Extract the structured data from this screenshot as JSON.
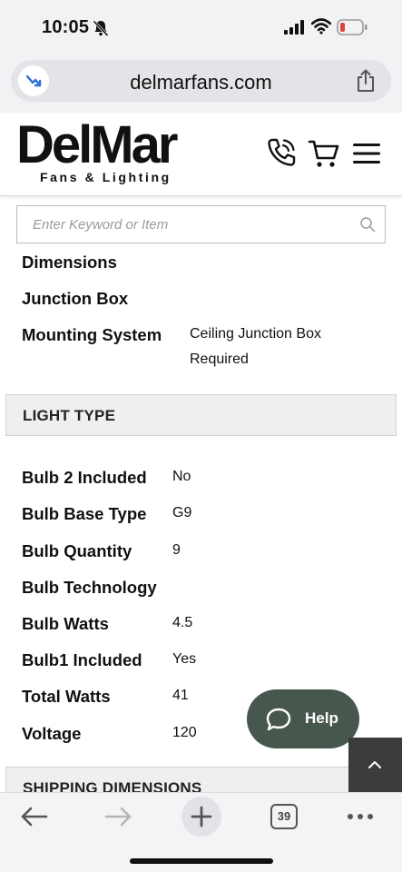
{
  "status_bar": {
    "time": "10:05",
    "icons": [
      "bell-muted-icon",
      "signal-icon",
      "wifi-icon",
      "battery-low-icon"
    ],
    "battery_color": "#e0443e"
  },
  "browser": {
    "url": "delmarfans.com",
    "tab_count": "39",
    "icons": [
      "back-icon",
      "forward-icon",
      "new-tab-icon",
      "tabs-icon",
      "more-icon",
      "share-icon"
    ]
  },
  "site": {
    "logo": "DelMar",
    "tagline": "Fans & Lighting",
    "header_icons": [
      "phone-icon",
      "cart-icon",
      "menu-icon"
    ]
  },
  "search": {
    "placeholder": "Enter Keyword or Item",
    "value": ""
  },
  "specs_top": [
    {
      "label": "Dimensions",
      "value": ""
    },
    {
      "label": "Junction Box",
      "value": ""
    },
    {
      "label": "Mounting System",
      "value_line1": "Ceiling Junction Box",
      "value_line2": "Required"
    }
  ],
  "light_type": {
    "title": "LIGHT TYPE",
    "rows": [
      {
        "label": "Bulb 2 Included",
        "value": "No"
      },
      {
        "label": "Bulb Base Type",
        "value": "G9"
      },
      {
        "label": "Bulb Quantity",
        "value": "9"
      },
      {
        "label": "Bulb Technology",
        "value": ""
      },
      {
        "label": "Bulb Watts",
        "value": "4.5"
      },
      {
        "label": "Bulb1 Included",
        "value": "Yes"
      },
      {
        "label": "Total Watts",
        "value": "41"
      },
      {
        "label": "Voltage",
        "value": "120"
      }
    ]
  },
  "next_section": {
    "title": "SHIPPING DIMENSIONS"
  },
  "help": {
    "label": "Help",
    "color": "#48574e"
  }
}
